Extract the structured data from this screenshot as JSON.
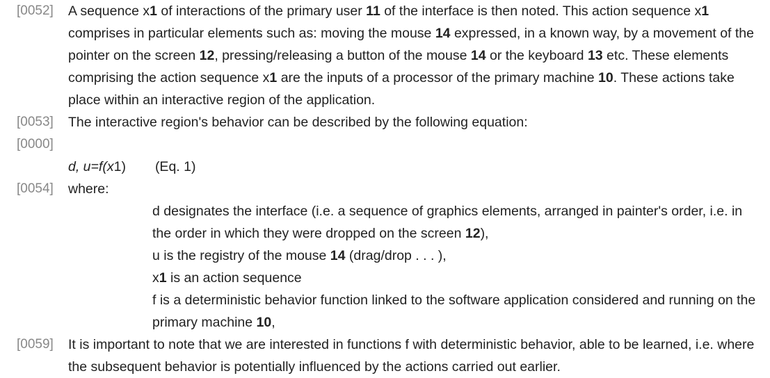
{
  "paragraphs": {
    "p52": {
      "num": "[0052]",
      "s1": "A sequence x",
      "b1": "1",
      "s2": " of interactions of the primary user ",
      "b2": "11",
      "s3": " of the interface is then noted. This action sequence x",
      "b3": "1",
      "s4": " comprises in particular elements such as: moving the mouse ",
      "b4": "14",
      "s5": " expressed, in a known way, by a movement of the pointer on the screen ",
      "b5": "12",
      "s6": ", pressing/releasing a button of the mouse ",
      "b6": "14",
      "s7": " or the keyboard ",
      "b7": "13",
      "s8": " etc. These elements comprising the action sequence x",
      "b8": "1",
      "s9": " are the inputs of a processor of the primary machine ",
      "b9": "10",
      "s10": ". These actions take place within an interactive region of the application."
    },
    "p53": {
      "num": "[0053]",
      "text": "The interactive region's behavior can be described by the following equation:"
    },
    "p00": {
      "num": "[0000]",
      "eq_italic": "d, u=f(x",
      "eq_one": "1",
      "eq_close": ")",
      "eq_label": "(Eq. 1)"
    },
    "p54": {
      "num": "[0054]",
      "text": "where:",
      "items": [
        {
          "s1": "d designates the interface (i.e. a sequence of graphics elements, arranged in painter's order, i.e. in the order in which they were dropped on the screen ",
          "b1": "12",
          "s2": "),"
        },
        {
          "s1": "u is the registry of the mouse ",
          "b1": "14",
          "s2": " (drag/drop . . . ),"
        },
        {
          "s1": "x",
          "b1": "1",
          "s2": " is an action sequence"
        },
        {
          "s1": "f is a deterministic behavior function linked to the software application considered and running on the primary machine ",
          "b1": "10",
          "s2": ","
        }
      ]
    },
    "p59": {
      "num": "[0059]",
      "text": "It is important to note that we are interested in functions f with deterministic behavior, able to be learned, i.e. where the subsequent behavior is potentially influenced by the actions carried out earlier."
    }
  }
}
